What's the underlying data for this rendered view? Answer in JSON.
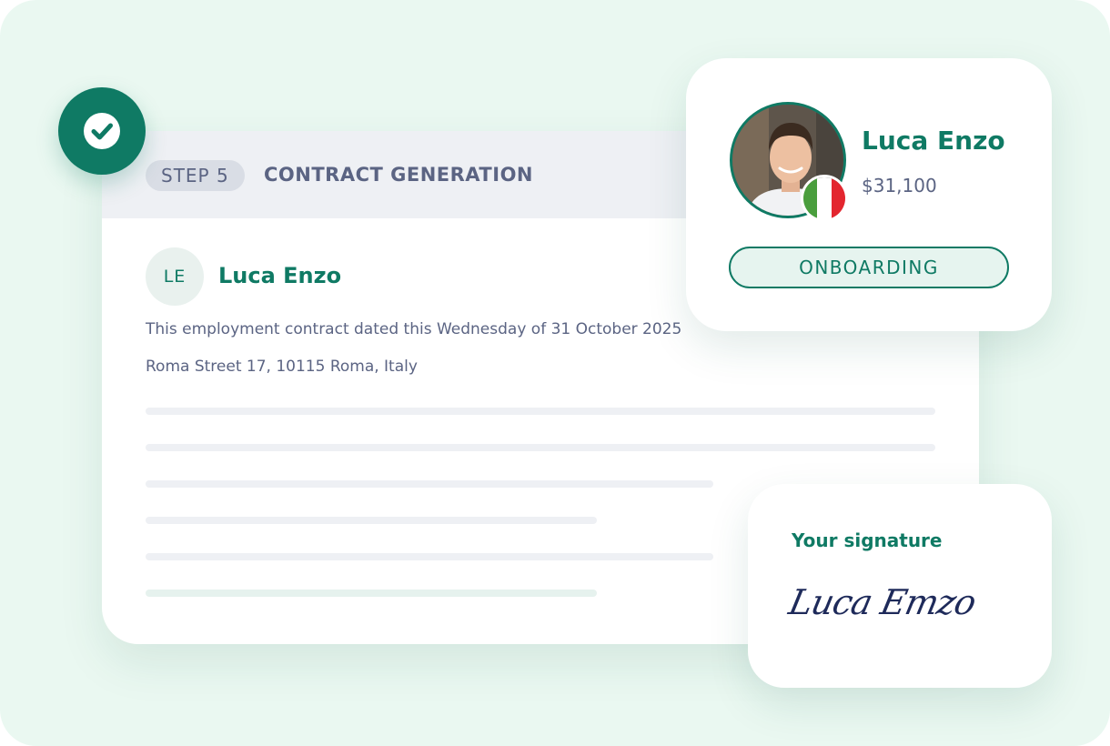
{
  "contract": {
    "step_label": "STEP 5",
    "title": "CONTRACT GENERATION",
    "initials": "LE",
    "name": "Luca Enzo",
    "line1": "This employment contract dated this Wednesday of 31 October 2025",
    "line2": "Roma Street 17, 10115 Roma, Italy"
  },
  "profile": {
    "name": "Luca Enzo",
    "salary": "$31,100",
    "status": "ONBOARDING",
    "flag_colors": [
      "#4a9e3d",
      "#ffffff",
      "#e3262f"
    ]
  },
  "signature": {
    "label": "Your signature",
    "value": "Luca Emzo"
  },
  "icons": {
    "badge": "check-icon"
  },
  "colors": {
    "accent": "#0f7a64",
    "background": "#eaf8f1",
    "text_muted": "#5b6483"
  }
}
